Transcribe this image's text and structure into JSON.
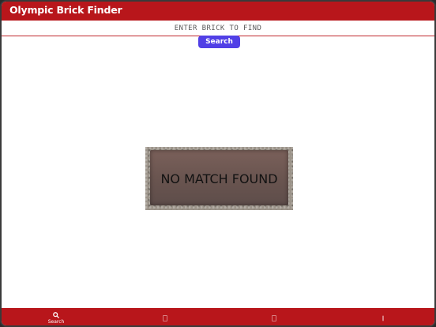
{
  "header": {
    "title": "Olympic Brick Finder"
  },
  "search": {
    "placeholder": "ENTER BRICK TO FIND",
    "button_label": "Search"
  },
  "result": {
    "message": "NO MATCH FOUND"
  },
  "tabbar": {
    "tabs": [
      {
        "label": "Search",
        "icon": "search-icon",
        "active": true
      },
      {
        "label": "",
        "icon": "tab-icon-2",
        "active": false
      },
      {
        "label": "",
        "icon": "tab-icon-3",
        "active": false
      },
      {
        "label": "",
        "icon": "tab-icon-4",
        "active": false
      }
    ]
  },
  "colors": {
    "brand_red": "#b8161b",
    "button_blue": "#5140e6"
  }
}
